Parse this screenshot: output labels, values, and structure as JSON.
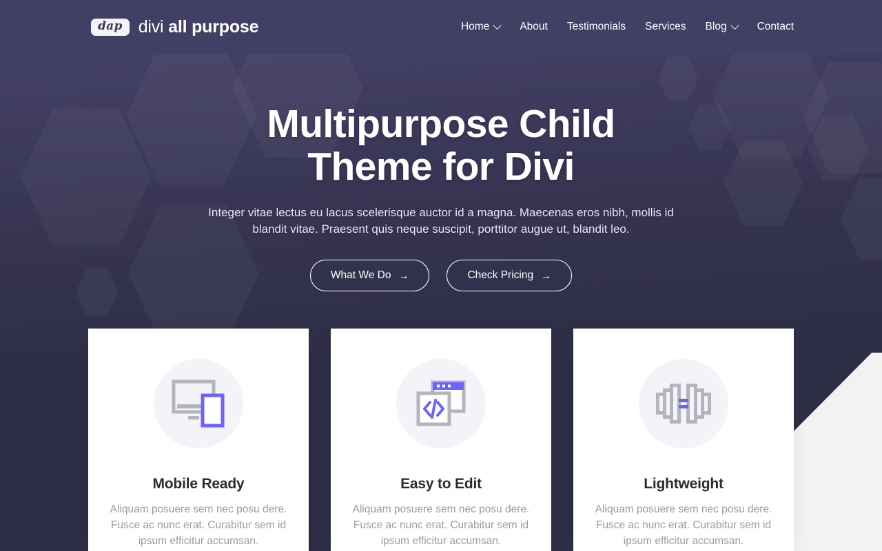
{
  "colors": {
    "header_bg": "#413f64",
    "hero_bg_top": "#454268",
    "hero_bg_bottom": "#2d2d45",
    "page_bg": "#2d2d45",
    "slab_bg": "#f2f2f3",
    "accent_purple": "#6c63ff",
    "icon_gray": "#b4b4bc",
    "icon_circle_bg": "#f3f3f8",
    "card_bg": "#ffffff",
    "card_title": "#2b2b33",
    "card_body": "#9a9aa2"
  },
  "header": {
    "logo": {
      "badge_text": "dap",
      "name_light": "divi ",
      "name_bold": "all purpose"
    },
    "nav": [
      {
        "label": "Home",
        "has_dropdown": true,
        "icon": "chevron-down-icon"
      },
      {
        "label": "About",
        "has_dropdown": false,
        "icon": ""
      },
      {
        "label": "Testimonials",
        "has_dropdown": false,
        "icon": ""
      },
      {
        "label": "Services",
        "has_dropdown": false,
        "icon": ""
      },
      {
        "label": "Blog",
        "has_dropdown": true,
        "icon": "chevron-down-icon"
      },
      {
        "label": "Contact",
        "has_dropdown": false,
        "icon": ""
      }
    ]
  },
  "hero": {
    "title_line1": "Multipurpose Child",
    "title_line2": "Theme for Divi",
    "subtitle": "Integer vitae lectus eu lacus scelerisque auctor id a magna. Maecenas eros nibh, mollis id blandit vitae. Praesent quis neque suscipit, porttitor augue ut, blandit leo.",
    "buttons": [
      {
        "label": "What We Do",
        "arrow": "→"
      },
      {
        "label": "Check Pricing",
        "arrow": "→"
      }
    ]
  },
  "features": [
    {
      "icon": "devices-responsive-icon",
      "title": "Mobile Ready",
      "body": "Aliquam posuere sem nec posu dere. Fusce ac nunc erat. Curabitur sem id ipsum efficitur accumsan."
    },
    {
      "icon": "code-window-icon",
      "title": "Easy to Edit",
      "body": "Aliquam posuere sem nec posu dere. Fusce ac nunc erat. Curabitur sem id ipsum efficitur accumsan."
    },
    {
      "icon": "dumbbell-icon",
      "title": "Lightweight",
      "body": "Aliquam posuere sem nec posu dere. Fusce ac nunc erat. Curabitur sem id ipsum efficitur accumsan."
    }
  ]
}
